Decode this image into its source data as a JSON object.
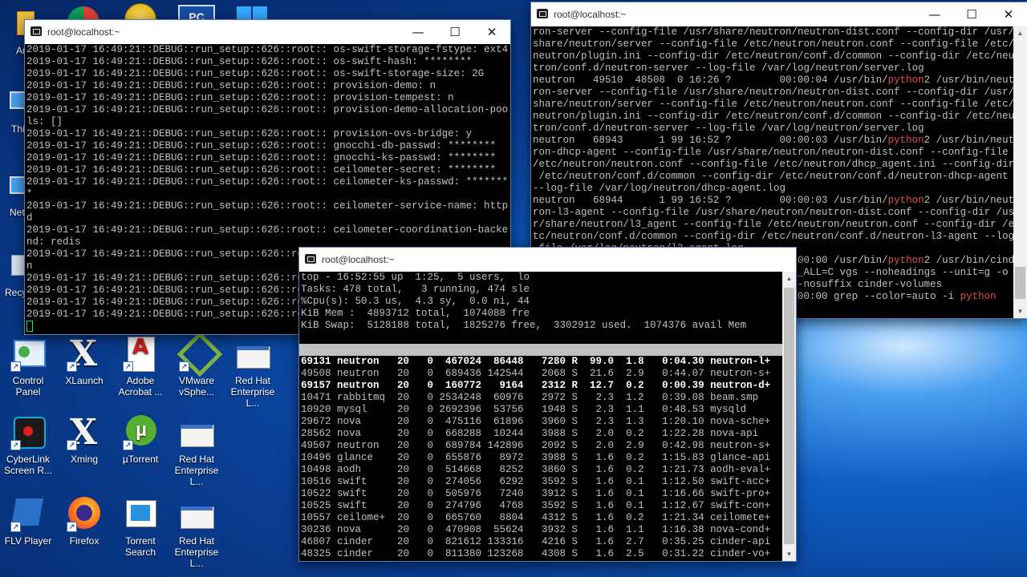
{
  "desktop": {
    "icons": [
      {
        "label": "Ar"
      },
      {
        "label": "Thi"
      },
      {
        "label": "Net"
      },
      {
        "label": "Recy"
      },
      {
        "label": "Control Panel"
      },
      {
        "label": "XLaunch"
      },
      {
        "label": "Adobe Acrobat ..."
      },
      {
        "label": "VMware vSphe..."
      },
      {
        "label": "Red Hat Enterprise L..."
      },
      {
        "label": "CyberLink Screen R..."
      },
      {
        "label": "Xming"
      },
      {
        "label": "µTorrent"
      },
      {
        "label": "Red Hat Enterprise L..."
      },
      {
        "label": "FLV Player"
      },
      {
        "label": "Firefox"
      },
      {
        "label": "Torrent Search"
      },
      {
        "label": "Red Hat Enterprise L..."
      }
    ]
  },
  "window_left": {
    "title": "root@localhost:~",
    "lines": [
      "2019-01-17 16:49:21::DEBUG::run_setup::626::root:: os-swift-storage-fstype: ext4",
      "2019-01-17 16:49:21::DEBUG::run_setup::626::root:: os-swift-hash: ********",
      "2019-01-17 16:49:21::DEBUG::run_setup::626::root:: os-swift-storage-size: 2G",
      "2019-01-17 16:49:21::DEBUG::run_setup::626::root:: provision-demo: n",
      "2019-01-17 16:49:21::DEBUG::run_setup::626::root:: provision-tempest: n",
      "2019-01-17 16:49:21::DEBUG::run_setup::626::root:: provision-demo-allocation-poo",
      "ls: []",
      "2019-01-17 16:49:21::DEBUG::run_setup::626::root:: provision-ovs-bridge: y",
      "2019-01-17 16:49:21::DEBUG::run_setup::626::root:: gnocchi-db-passwd: ********",
      "2019-01-17 16:49:21::DEBUG::run_setup::626::root:: gnocchi-ks-passwd: ********",
      "2019-01-17 16:49:21::DEBUG::run_setup::626::root:: ceilometer-secret: ********",
      "2019-01-17 16:49:21::DEBUG::run_setup::626::root:: ceilometer-ks-passwd: *******",
      "*",
      "2019-01-17 16:49:21::DEBUG::run_setup::626::root:: ceilometer-service-name: http",
      "d",
      "2019-01-17 16:49:21::DEBUG::run_setup::626::root:: ceilometer-coordination-backe",
      "nd: redis",
      "2019-01-17 16:49:21::DEBUG::run_setup::626::root:: ",
      "n",
      "2019-01-17 16:49:21::DEBUG::run_setup::626::ro",
      "2019-01-17 16:49:21::DEBUG::run_setup::626::ro",
      "2019-01-17 16:49:21::DEBUG::run_setup::626::ro",
      "2019-01-17 16:49:21::DEBUG::run_setup::626::ro"
    ]
  },
  "window_right": {
    "title": "root@localhost:~",
    "lines": [
      "ron-server --config-file /usr/share/neutron/neutron-dist.conf --config-dir /usr/",
      "share/neutron/server --config-file /etc/neutron/neutron.conf --config-file /etc/",
      "neutron/plugin.ini --config-dir /etc/neutron/conf.d/common --config-dir /etc/neu",
      "tron/conf.d/neutron-server --log-file /var/log/neutron/server.log",
      "neutron   49510  48508  0 16:26 ?        00:00:04 /usr/bin/python2 /usr/bin/neut",
      "ron-server --config-file /usr/share/neutron/neutron-dist.conf --config-dir /usr/",
      "share/neutron/server --config-file /etc/neutron/neutron.conf --config-file /etc/",
      "neutron/plugin.ini --config-dir /etc/neutron/conf.d/common --config-dir /etc/neu",
      "tron/conf.d/neutron-server --log-file /var/log/neutron/server.log",
      "neutron   68943      1 99 16:52 ?        00:00:03 /usr/bin/python2 /usr/bin/neut",
      "ron-dhcp-agent --config-file /usr/share/neutron/neutron-dist.conf --config-file",
      "/etc/neutron/neutron.conf --config-file /etc/neutron/dhcp_agent.ini --config-dir",
      " /etc/neutron/conf.d/common --config-dir /etc/neutron/conf.d/neutron-dhcp-agent",
      "--log-file /var/log/neutron/dhcp-agent.log",
      "neutron   68944      1 99 16:52 ?        00:00:03 /usr/bin/python2 /usr/bin/neut",
      "ron-l3-agent --config-file /usr/share/neutron/neutron-dist.conf --config-dir /us",
      "r/share/neutron/l3_agent --config-file /etc/neutron/neutron.conf --config-dir /e",
      "tc/neutron/conf.d/common --config-dir /etc/neutron/conf.d/neutron-l3-agent --log",
      "-file /var/log/neutron/l3-agent.log",
      "root      68972  68969  0 16:52 ?        00:00:00 /usr/bin/python2 /usr/bin/cind",
      "er-rootwrap /etc/cinder/rootwrap.conf env LC_ALL=C vgs --noheadings --unit=g -o",
      "name,size,free,lv_count,uuid --separator : --nosuffix cinder-volumes",
      "root      68976  37166  0 16:52 pts/0    00:00:00 grep --color=auto -i python"
    ],
    "prompt": "[root@localhost ~]# "
  },
  "window_top": {
    "title": "root@localhost:~",
    "summary": [
      "top - 16:52:55 up  1:25,  5 users,  lo",
      "Tasks: 478 total,   3 running, 474 sle",
      "%Cpu(s): 50.3 us,  4.3 sy,  0.0 ni, 44",
      "KiB Mem :  4893712 total,  1074088 fre",
      "KiB Swap:  5128188 total,  1825276 free,  3302912 used.  1074376 avail Mem"
    ],
    "header": "  PID USER      PR  NI    VIRT    RES    SHR S  %CPU %MEM     TIME+ COMMAND    ",
    "rows": [
      {
        "bold": true,
        "text": "69131 neutron   20   0  467024  86448   7280 R  99.0  1.8   0:04.30 neutron-l+"
      },
      {
        "bold": false,
        "text": "49508 neutron   20   0  689436 142544   2068 S  21.6  2.9   0:44.07 neutron-s+"
      },
      {
        "bold": true,
        "text": "69157 neutron   20   0  160772   9164   2312 R  12.7  0.2   0:00.39 neutron-d+"
      },
      {
        "bold": false,
        "text": "10471 rabbitmq  20   0 2534248  60976   2972 S   2.3  1.2   0:39.08 beam.smp  "
      },
      {
        "bold": false,
        "text": "10920 mysql     20   0 2692396  53756   1948 S   2.3  1.1   0:48.53 mysqld    "
      },
      {
        "bold": false,
        "text": "29672 nova      20   0  475116  61896   3960 S   2.3  1.3   1:20.10 nova-sche+"
      },
      {
        "bold": false,
        "text": "28562 nova      20   0  668288  10244   3988 S   2.0  0.2   1:22.28 nova-api  "
      },
      {
        "bold": false,
        "text": "49507 neutron   20   0  689784 142896   2092 S   2.0  2.9   0:42.98 neutron-s+"
      },
      {
        "bold": false,
        "text": "10496 glance    20   0  655876   8972   3988 S   1.6  0.2   1:15.83 glance-api"
      },
      {
        "bold": false,
        "text": "10498 aodh      20   0  514668   8252   3860 S   1.6  0.2   1:21.73 aodh-eval+"
      },
      {
        "bold": false,
        "text": "10516 swift     20   0  274056   6292   3592 S   1.6  0.1   1:12.50 swift-acc+"
      },
      {
        "bold": false,
        "text": "10522 swift     20   0  505976   7240   3912 S   1.6  0.1   1:16.66 swift-pro+"
      },
      {
        "bold": false,
        "text": "10525 swift     20   0  274796   4768   3592 S   1.6  0.1   1:12.67 swift-con+"
      },
      {
        "bold": false,
        "text": "10557 ceilome+  20   0  665760   8804   4312 S   1.6  0.2   1:21.34 ceilomete+"
      },
      {
        "bold": false,
        "text": "30236 nova      20   0  470908  55624   3932 S   1.6  1.1   1:16.38 nova-cond+"
      },
      {
        "bold": false,
        "text": "46807 cinder    20   0  821612 133316   4216 S   1.6  2.7   0:35.25 cinder-api"
      },
      {
        "bold": false,
        "text": "48325 cinder    20   0  811380 123268   4308 S   1.6  2.5   0:31.22 cinder-vo+"
      }
    ]
  }
}
